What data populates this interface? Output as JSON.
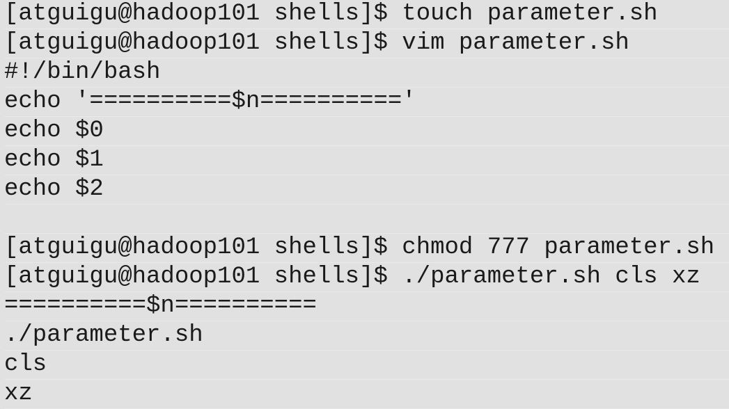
{
  "terminal": {
    "lines": [
      "[atguigu@hadoop101 shells]$ touch parameter.sh",
      "[atguigu@hadoop101 shells]$ vim parameter.sh",
      "#!/bin/bash",
      "echo '==========$n=========='",
      "echo $0",
      "echo $1",
      "echo $2",
      "",
      "[atguigu@hadoop101 shells]$ chmod 777 parameter.sh",
      "[atguigu@hadoop101 shells]$ ./parameter.sh cls xz",
      "==========$n==========",
      "./parameter.sh",
      "cls",
      "xz"
    ]
  }
}
